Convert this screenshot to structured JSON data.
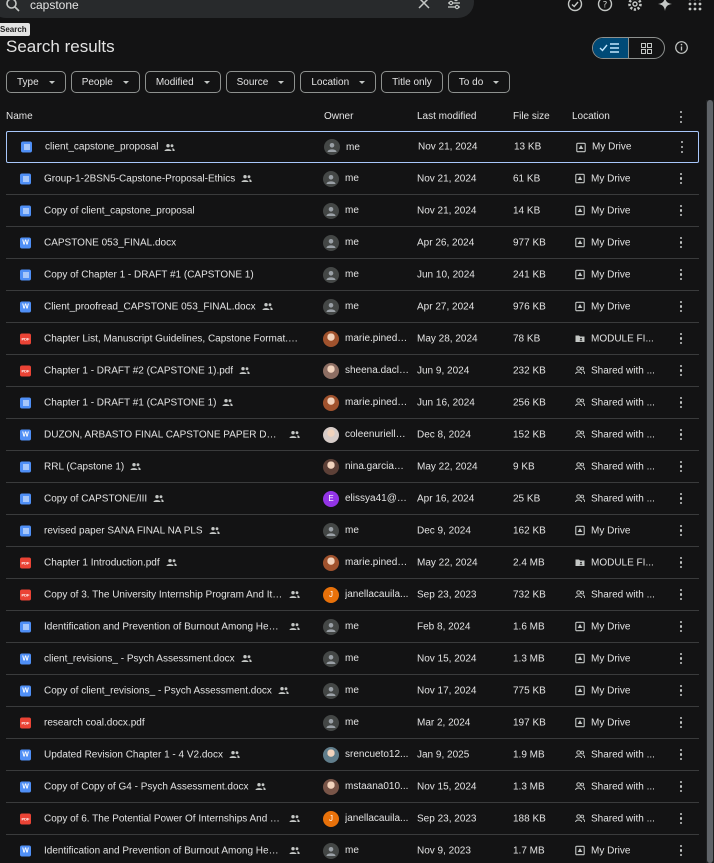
{
  "search": {
    "query": "capstone",
    "tooltip": "Search"
  },
  "page_title": "Search results",
  "chips": [
    "Type",
    "People",
    "Modified",
    "Source",
    "Location",
    "Title only",
    "To do"
  ],
  "chips_with_caret": [
    true,
    true,
    true,
    true,
    true,
    false,
    true
  ],
  "columns": {
    "name": "Name",
    "owner": "Owner",
    "modified": "Last modified",
    "size": "File size",
    "location": "Location"
  },
  "files": [
    {
      "name": "client_capstone_proposal",
      "type": "doc",
      "shared": true,
      "owner": "me",
      "avatar": "me",
      "modified": "Nov 21, 2024",
      "size": "13 KB",
      "location": "My Drive",
      "loc_icon": "drive"
    },
    {
      "name": "Group-1-2BSN5-Capstone-Proposal-Ethics",
      "type": "doc",
      "shared": true,
      "owner": "me",
      "avatar": "me",
      "modified": "Nov 21, 2024",
      "size": "61 KB",
      "location": "My Drive",
      "loc_icon": "drive"
    },
    {
      "name": "Copy of client_capstone_proposal",
      "type": "doc",
      "shared": false,
      "owner": "me",
      "avatar": "me",
      "modified": "Nov 21, 2024",
      "size": "14 KB",
      "location": "My Drive",
      "loc_icon": "drive"
    },
    {
      "name": "CAPSTONE 053_FINAL.docx",
      "type": "word",
      "shared": false,
      "owner": "me",
      "avatar": "me",
      "modified": "Apr 26, 2024",
      "size": "977 KB",
      "location": "My Drive",
      "loc_icon": "drive"
    },
    {
      "name": "Copy of Chapter 1 - DRAFT #1 (CAPSTONE 1)",
      "type": "doc",
      "shared": false,
      "owner": "me",
      "avatar": "me",
      "modified": "Jun 10, 2024",
      "size": "241 KB",
      "location": "My Drive",
      "loc_icon": "drive"
    },
    {
      "name": "Client_proofread_CAPSTONE 053_FINAL.docx",
      "type": "word",
      "shared": true,
      "owner": "me",
      "avatar": "me",
      "modified": "Apr 27, 2024",
      "size": "976 KB",
      "location": "My Drive",
      "loc_icon": "drive"
    },
    {
      "name": "Chapter List, Manuscript Guidelines, Capstone Format.pdf",
      "type": "pdf",
      "shared": false,
      "owner": "marie.pineda...",
      "avatar": "photo",
      "avatar_color": "#a0522d",
      "modified": "May 28, 2024",
      "size": "78 KB",
      "location": "MODULE FI...",
      "loc_icon": "shared-folder"
    },
    {
      "name": "Chapter 1 - DRAFT #2 (CAPSTONE 1).pdf",
      "type": "pdf",
      "shared": true,
      "owner": "sheena.dacle...",
      "avatar": "photo",
      "avatar_color": "#8d6e63",
      "modified": "Jun 9, 2024",
      "size": "232 KB",
      "location": "Shared with ...",
      "loc_icon": "people"
    },
    {
      "name": "Chapter 1 - DRAFT #1 (CAPSTONE 1)",
      "type": "doc",
      "shared": true,
      "owner": "marie.pineda...",
      "avatar": "photo",
      "avatar_color": "#a0522d",
      "modified": "Jun 16, 2024",
      "size": "256 KB",
      "location": "Shared with ...",
      "loc_icon": "people"
    },
    {
      "name": "DUZON, ARBASTO FINAL CAPSTONE PAPER DRAFT.docx",
      "type": "word",
      "shared": true,
      "owner": "coleenurielle...",
      "avatar": "photo",
      "avatar_color": "#d7ccc8",
      "modified": "Dec 8, 2024",
      "size": "152 KB",
      "location": "Shared with ...",
      "loc_icon": "people"
    },
    {
      "name": "RRL (Capstone 1)",
      "type": "doc",
      "shared": true,
      "owner": "nina.garcia@...",
      "avatar": "photo",
      "avatar_color": "#5d4037",
      "modified": "May 22, 2024",
      "size": "9 KB",
      "location": "Shared with ...",
      "loc_icon": "people"
    },
    {
      "name": "Copy of CAPSTONE/III",
      "type": "doc",
      "shared": true,
      "owner": "elissya41@g...",
      "avatar": "letter",
      "avatar_letter": "E",
      "avatar_color": "#9334e6",
      "modified": "Apr 16, 2024",
      "size": "25 KB",
      "location": "Shared with ...",
      "loc_icon": "people"
    },
    {
      "name": "revised paper SANA FINAL NA PLS",
      "type": "doc",
      "shared": true,
      "owner": "me",
      "avatar": "me",
      "modified": "Dec 9, 2024",
      "size": "162 KB",
      "location": "My Drive",
      "loc_icon": "drive"
    },
    {
      "name": "Chapter 1 Introduction.pdf",
      "type": "pdf",
      "shared": true,
      "owner": "marie.pineda...",
      "avatar": "photo",
      "avatar_color": "#a0522d",
      "modified": "May 22, 2024",
      "size": "2.4 MB",
      "location": "MODULE FI...",
      "loc_icon": "shared-folder"
    },
    {
      "name": "Copy of 3. The University Internship Program And Its Effects",
      "type": "pdf",
      "shared": true,
      "owner": "janellacauila...",
      "avatar": "letter",
      "avatar_letter": "J",
      "avatar_color": "#e8710a",
      "modified": "Sep 23, 2023",
      "size": "732 KB",
      "location": "Shared with ...",
      "loc_icon": "people"
    },
    {
      "name": "Identification and Prevention of Burnout Among Health Care",
      "type": "doc",
      "shared": true,
      "owner": "me",
      "avatar": "me",
      "modified": "Feb 8, 2024",
      "size": "1.6 MB",
      "location": "My Drive",
      "loc_icon": "drive"
    },
    {
      "name": "client_revisions_ - Psych Assessment.docx",
      "type": "word",
      "shared": true,
      "owner": "me",
      "avatar": "me",
      "modified": "Nov 15, 2024",
      "size": "1.3 MB",
      "location": "My Drive",
      "loc_icon": "drive"
    },
    {
      "name": "Copy of client_revisions_ - Psych Assessment.docx",
      "type": "word",
      "shared": true,
      "owner": "me",
      "avatar": "me",
      "modified": "Nov 17, 2024",
      "size": "775 KB",
      "location": "My Drive",
      "loc_icon": "drive"
    },
    {
      "name": "research coal.docx.pdf",
      "type": "pdf",
      "shared": false,
      "owner": "me",
      "avatar": "me",
      "modified": "Mar 2, 2024",
      "size": "197 KB",
      "location": "My Drive",
      "loc_icon": "drive"
    },
    {
      "name": "Updated Revision Chapter  1 - 4 V2.docx",
      "type": "word",
      "shared": true,
      "owner": "srencueto12...",
      "avatar": "photo",
      "avatar_color": "#607d8b",
      "modified": "Jan 9, 2025",
      "size": "1.9 MB",
      "location": "Shared with ...",
      "loc_icon": "people"
    },
    {
      "name": "Copy of Copy of G4 - Psych Assessment.docx",
      "type": "word",
      "shared": true,
      "owner": "mstaana010...",
      "avatar": "photo",
      "avatar_color": "#795548",
      "modified": "Nov 15, 2024",
      "size": "1.3 MB",
      "location": "Shared with ...",
      "loc_icon": "people"
    },
    {
      "name": "Copy of 6. The Potential Power Of Internships And The Impact",
      "type": "pdf",
      "shared": true,
      "owner": "janellacauila...",
      "avatar": "letter",
      "avatar_letter": "J",
      "avatar_color": "#e8710a",
      "modified": "Sep 23, 2023",
      "size": "188 KB",
      "location": "Shared with ...",
      "loc_icon": "people"
    },
    {
      "name": "Identification and Prevention of Burnout Among Health Care",
      "type": "word",
      "shared": true,
      "owner": "me",
      "avatar": "me",
      "modified": "Nov 9, 2023",
      "size": "1.7 MB",
      "location": "My Drive",
      "loc_icon": "drive"
    }
  ]
}
